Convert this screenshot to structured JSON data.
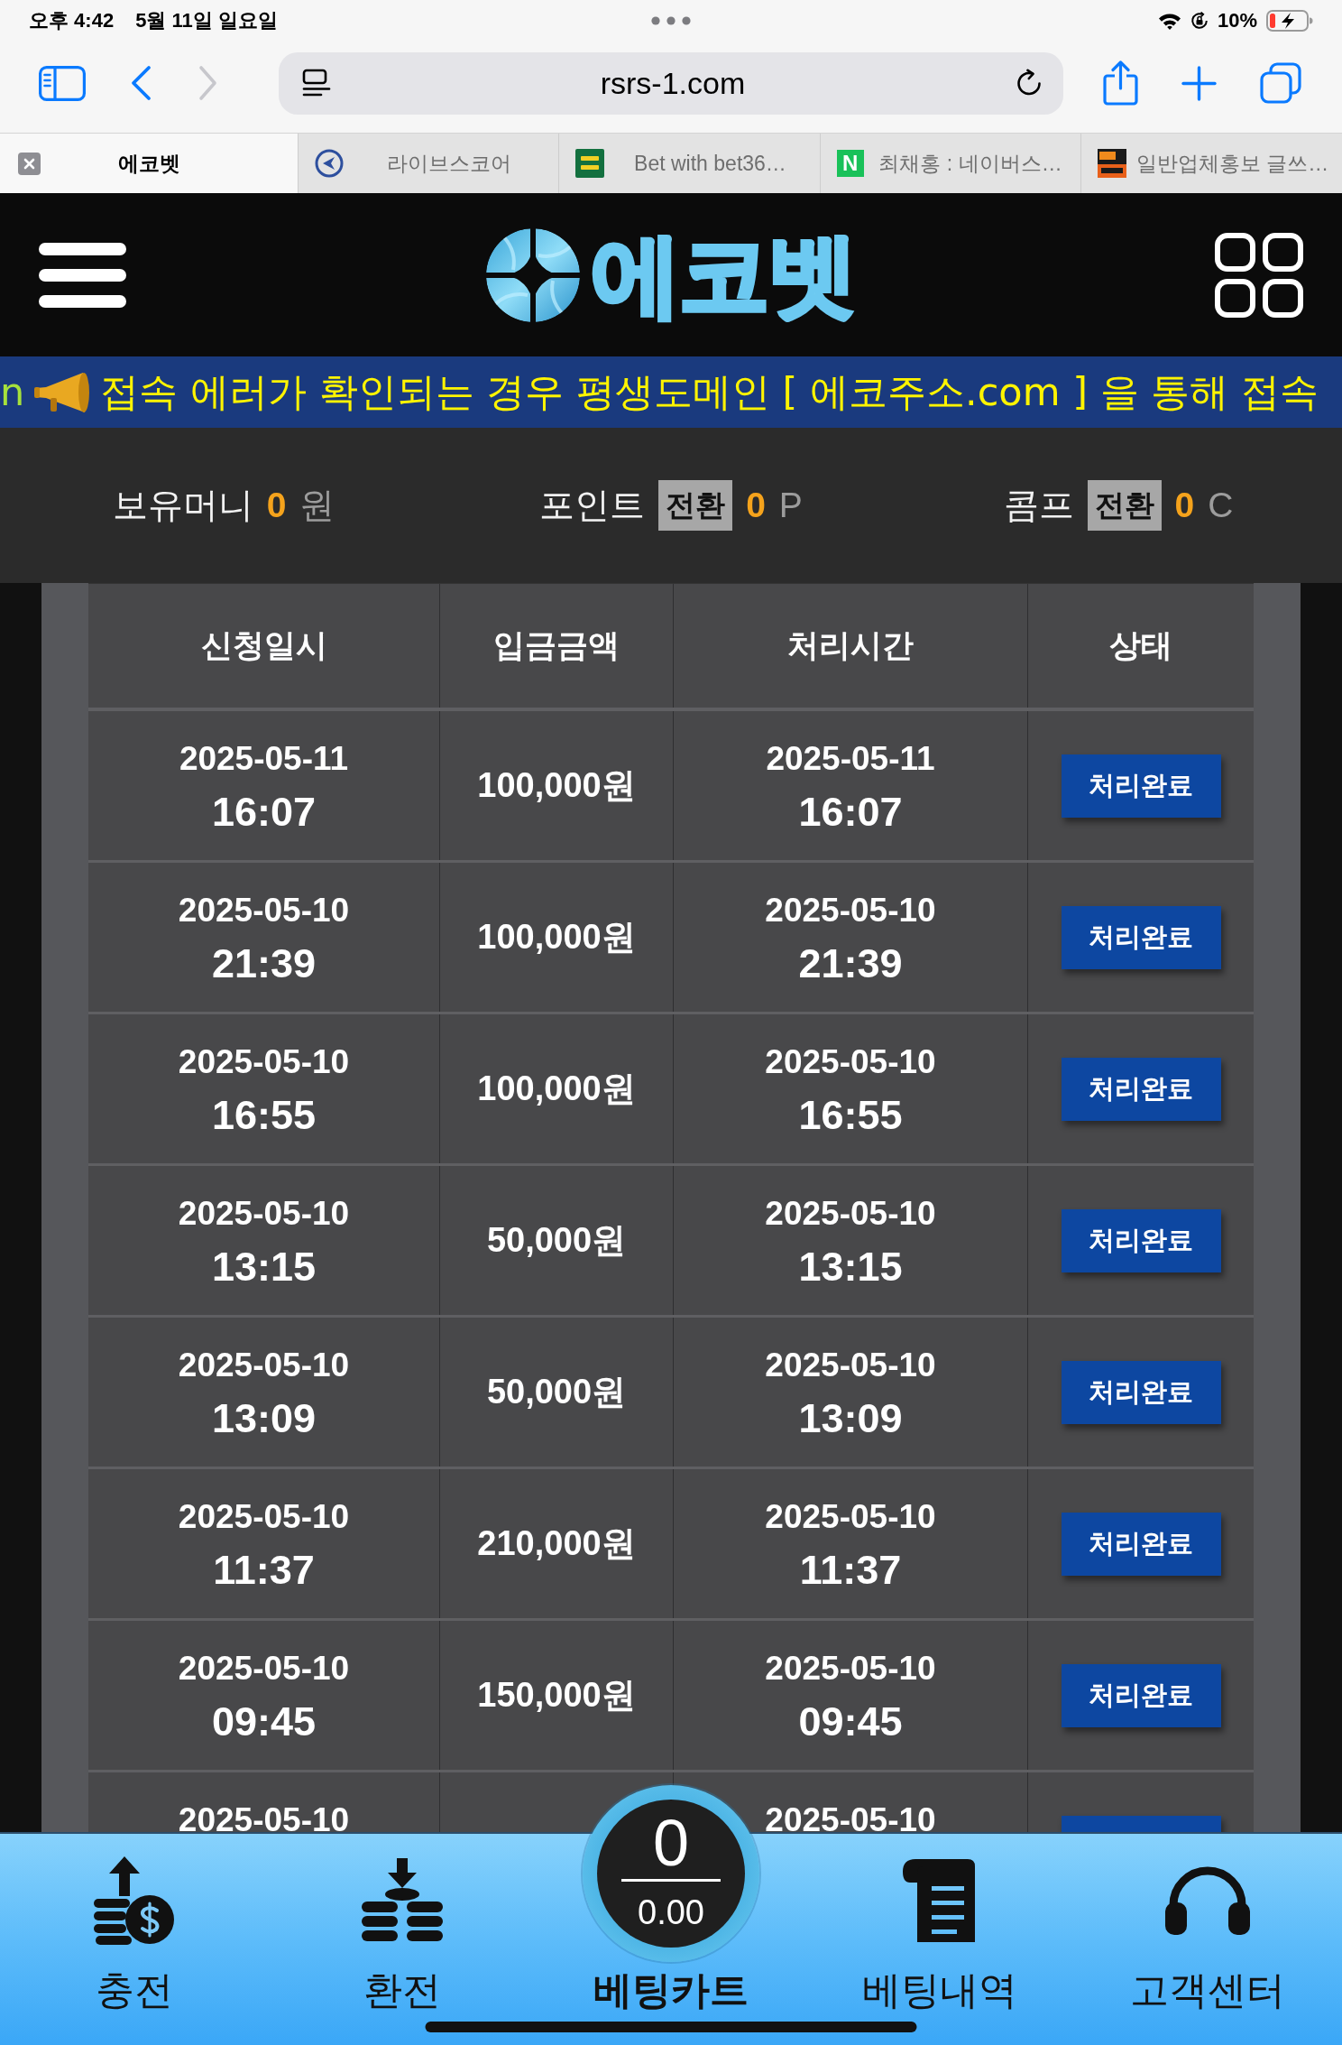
{
  "status_bar": {
    "time": "오후 4:42",
    "date": "5월 11일 일요일",
    "battery": "10%"
  },
  "browser": {
    "url": "rsrs-1.com",
    "tabs": [
      {
        "title": "에코벳",
        "selected": true
      },
      {
        "title": "라이브스코어",
        "selected": false,
        "kind": "ring"
      },
      {
        "title": "Bet with bet36…",
        "selected": false,
        "kind": "tile"
      },
      {
        "title": "최채홍 : 네이버스…",
        "selected": false,
        "kind": "letter",
        "mark": "N"
      },
      {
        "title": "일반업체홍보 글쓰…",
        "selected": false,
        "kind": "banner"
      }
    ]
  },
  "header": {
    "logo": "에코벳"
  },
  "notice": {
    "lead": "n",
    "text": "접속 에러가 확인되는 경우 평생도메인 [ 에코주소.com ] 을 통해 접속"
  },
  "balance": [
    {
      "label": "보유머니",
      "value": "0",
      "unit": "원"
    },
    {
      "label": "포인트",
      "button": "전환",
      "value": "0",
      "unit": "P"
    },
    {
      "label": "콤프",
      "button": "전환",
      "value": "0",
      "unit": "C"
    }
  ],
  "table": {
    "columns": [
      "신청일시",
      "입금금액",
      "처리시간",
      "상태"
    ],
    "rows": [
      {
        "applied_date": "2025-05-11",
        "applied_time": "16:07",
        "amount": "100,000원",
        "processed_date": "2025-05-11",
        "processed_time": "16:07",
        "status": "처리완료"
      },
      {
        "applied_date": "2025-05-10",
        "applied_time": "21:39",
        "amount": "100,000원",
        "processed_date": "2025-05-10",
        "processed_time": "21:39",
        "status": "처리완료"
      },
      {
        "applied_date": "2025-05-10",
        "applied_time": "16:55",
        "amount": "100,000원",
        "processed_date": "2025-05-10",
        "processed_time": "16:55",
        "status": "처리완료"
      },
      {
        "applied_date": "2025-05-10",
        "applied_time": "13:15",
        "amount": "50,000원",
        "processed_date": "2025-05-10",
        "processed_time": "13:15",
        "status": "처리완료"
      },
      {
        "applied_date": "2025-05-10",
        "applied_time": "13:09",
        "amount": "50,000원",
        "processed_date": "2025-05-10",
        "processed_time": "13:09",
        "status": "처리완료"
      },
      {
        "applied_date": "2025-05-10",
        "applied_time": "11:37",
        "amount": "210,000원",
        "processed_date": "2025-05-10",
        "processed_time": "11:37",
        "status": "처리완료"
      },
      {
        "applied_date": "2025-05-10",
        "applied_time": "09:45",
        "amount": "150,000원",
        "processed_date": "2025-05-10",
        "processed_time": "09:45",
        "status": "처리완료"
      },
      {
        "applied_date": "2025-05-10",
        "processed_date": "2025-05-10"
      }
    ]
  },
  "bottom_nav": [
    {
      "kind": "charge",
      "label": "충전"
    },
    {
      "kind": "exchange",
      "label": "환전"
    },
    {
      "kind": "cart",
      "label": "베팅카트",
      "count": "0",
      "amount": "0.00"
    },
    {
      "kind": "history",
      "label": "베팅내역"
    },
    {
      "kind": "support",
      "label": "고객센터"
    }
  ]
}
